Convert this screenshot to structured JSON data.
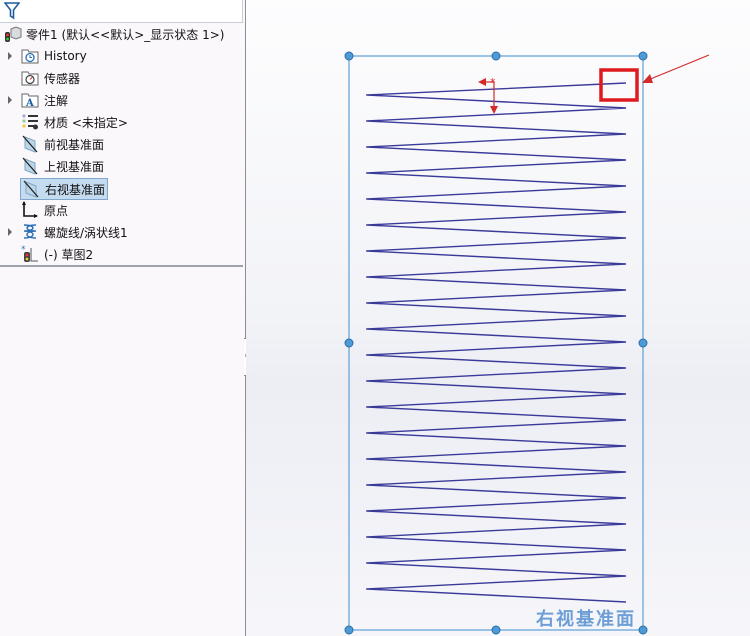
{
  "feature_tree": {
    "filter_icon": "filter-icon",
    "part": {
      "label": "零件1  (默认<<默认>_显示状态 1>)",
      "icon": "part-icon"
    },
    "items": [
      {
        "label": "History",
        "icon": "history-folder-icon",
        "expandable": true,
        "selected": false
      },
      {
        "label": "传感器",
        "icon": "sensor-folder-icon",
        "expandable": false,
        "selected": false
      },
      {
        "label": "注解",
        "icon": "annotation-folder-icon",
        "expandable": true,
        "selected": false
      },
      {
        "label": "材质 <未指定>",
        "icon": "material-icon",
        "expandable": false,
        "selected": false
      },
      {
        "label": "前视基准面",
        "icon": "plane-icon",
        "expandable": false,
        "selected": false
      },
      {
        "label": "上视基准面",
        "icon": "plane-icon",
        "expandable": false,
        "selected": false
      },
      {
        "label": "右视基准面",
        "icon": "plane-icon",
        "expandable": false,
        "selected": true
      },
      {
        "label": "原点",
        "icon": "origin-icon",
        "expandable": false,
        "selected": false
      },
      {
        "label": "螺旋线/涡状线1",
        "icon": "helix-icon",
        "expandable": true,
        "selected": false
      },
      {
        "label": "(-) 草图2",
        "icon": "sketch-icon",
        "expandable": false,
        "selected": false
      }
    ]
  },
  "viewport": {
    "plane_label": "右视基准面",
    "helix": {
      "revolutions": 20
    },
    "colors": {
      "helix": "#3a3a9a",
      "plane_border": "#6aa6d8",
      "highlight": "#e0191e",
      "arrow": "#d42a2a"
    }
  }
}
